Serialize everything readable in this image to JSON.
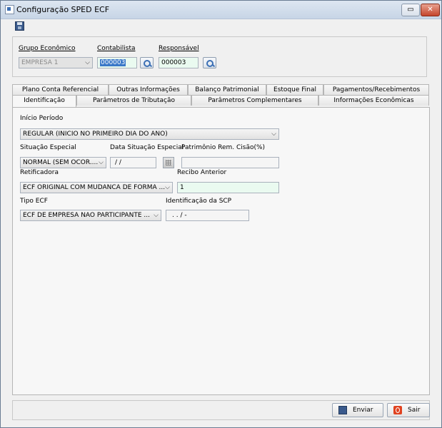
{
  "window": {
    "title": "Configuração SPED ECF",
    "restore_glyph": "▭",
    "close_glyph": "✕"
  },
  "header": {
    "grupo_label": "Grupo Econômico",
    "grupo_value": "EMPRESA 1",
    "contabilista_label": "Contabilista",
    "contabilista_value": "000003",
    "responsavel_label": "Responsável",
    "responsavel_value": "000003"
  },
  "tabs": {
    "row1": [
      "Plano Conta Referencial",
      "Outras Informações",
      "Balanço Patrimonial",
      "Estoque Final",
      "Pagamentos/Recebimentos"
    ],
    "row2": [
      "Identificação",
      "Parâmetros de Tributação",
      "Parâmetros Complementares",
      "Informações Econômicas"
    ],
    "active": "Identificação"
  },
  "form": {
    "inicio_periodo_label": "Início Período",
    "inicio_periodo_value": "REGULAR (INICIO NO PRIMEIRO DIA DO ANO)",
    "situacao_label": "Situação Especial",
    "situacao_value": "NORMAL (SEM OCOR....",
    "data_situacao_label": "Data Situação Especial",
    "data_situacao_value": "/ /",
    "patrimonio_label": "Patrimônio Rem. Cisão(%)",
    "patrimonio_value": "",
    "retificadora_label": "Retificadora",
    "retificadora_value": "ECF ORIGINAL COM MUDANCA DE FORMA ...",
    "recibo_label": "Recibo Anterior",
    "recibo_value": "1",
    "tipo_ecf_label": "Tipo ECF",
    "tipo_ecf_value": "ECF DE EMPRESA NAO PARTICIPANTE ...",
    "id_scp_label": "Identificação da SCP",
    "id_scp_value": ". . / -"
  },
  "buttons": {
    "enviar": "Enviar",
    "sair": "Sair"
  },
  "icons": {
    "dropdown": "⌵"
  }
}
